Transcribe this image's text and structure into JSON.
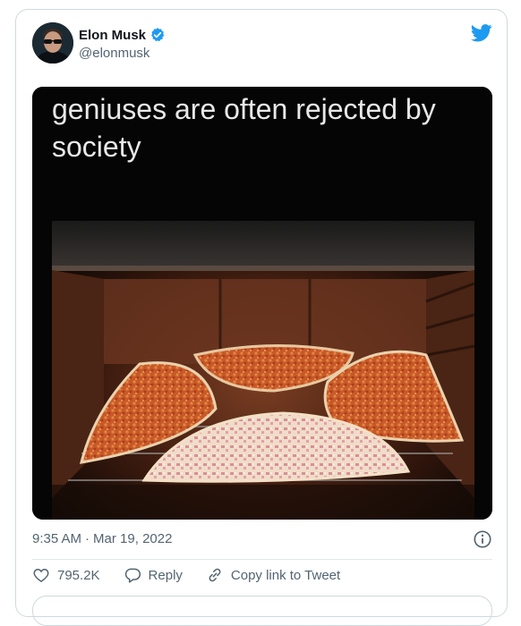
{
  "tweet": {
    "author_name": "Elon Musk",
    "author_handle": "@elonmusk",
    "image_caption": "geniuses are often rejected by society",
    "time": "9:35 AM",
    "separator": "·",
    "date": "Mar 19, 2022"
  },
  "actions": {
    "likes": "795.2K",
    "reply_label": "Reply",
    "copy_link_label": "Copy link to Tweet"
  },
  "colors": {
    "twitter_blue": "#1d9bf0",
    "verified_badge": "#1d9bf0",
    "secondary_text": "#536471"
  },
  "icons": [
    "twitter-bird-icon",
    "verified-badge-icon",
    "info-icon",
    "heart-icon",
    "reply-icon",
    "link-icon"
  ]
}
